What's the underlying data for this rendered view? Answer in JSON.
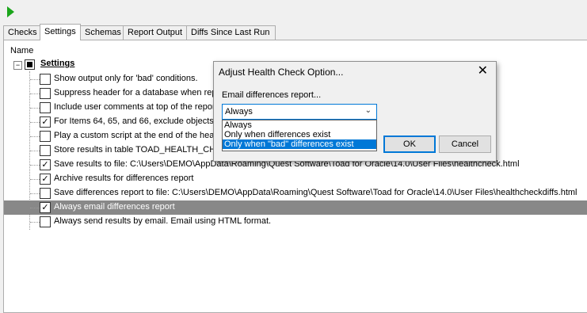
{
  "toolbar": {
    "run_icon": "play-icon",
    "run_color": "#1aa51a"
  },
  "tabs": [
    {
      "label": "Checks"
    },
    {
      "label": "Settings"
    },
    {
      "label": "Schemas"
    },
    {
      "label": "Report Output"
    },
    {
      "label": "Diffs Since Last Run"
    }
  ],
  "tree": {
    "column_header": "Name",
    "expander_symbol": "−",
    "root_label": "Settings",
    "items": [
      {
        "label": "Show output only for 'bad' conditions.",
        "checked": false
      },
      {
        "label": "Suppress header for a database when rep",
        "checked": false
      },
      {
        "label": "Include user comments at top of the repor",
        "checked": false
      },
      {
        "label": "For Items 64, 65, and 66, exclude objects",
        "checked": true
      },
      {
        "label": "Play a custom script at the end of the hea",
        "checked": false
      },
      {
        "label": "Store results in table TOAD_HEALTH_CHEC",
        "checked": false
      },
      {
        "label": "Save results to file: C:\\Users\\DEMO\\AppData\\Roaming\\Quest Software\\Toad for Oracle\\14.0\\User Files\\healthcheck.html",
        "checked": true
      },
      {
        "label": "Archive results for differences report",
        "checked": true
      },
      {
        "label": "Save differences report to file: C:\\Users\\DEMO\\AppData\\Roaming\\Quest Software\\Toad for Oracle\\14.0\\User Files\\healthcheckdiffs.html",
        "checked": false
      },
      {
        "label": "Always email differences report",
        "checked": true,
        "selected": true
      },
      {
        "label": "Always send results by email.  Email using HTML format.",
        "checked": false
      }
    ]
  },
  "dialog": {
    "title": "Adjust Health Check Option...",
    "close": "✕",
    "field_label": "Email differences report...",
    "combo_value": "Always",
    "combo_arrow": "⌄",
    "options": [
      {
        "label": "Always",
        "selected": false
      },
      {
        "label": "Only when differences exist",
        "selected": false
      },
      {
        "label": "Only when \"bad\" differences exist",
        "selected": true
      }
    ],
    "ok_label": "OK",
    "cancel_label": "Cancel"
  }
}
